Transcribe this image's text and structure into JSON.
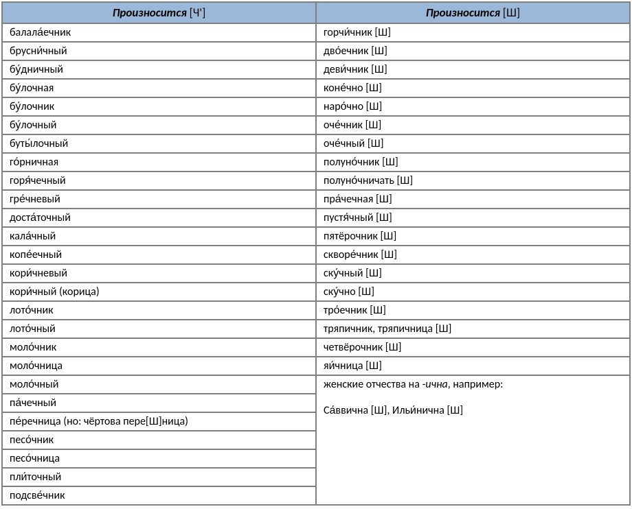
{
  "headers": {
    "col1_italic": "Произносится",
    "col1_suffix": " [Ч']",
    "col2_italic": "Произносится",
    "col2_suffix": " [Ш]"
  },
  "rows": [
    {
      "c1": "балала́ечник",
      "c2": "горчи́чник [Ш]"
    },
    {
      "c1": "брусни́чный",
      "c2": "дво́ечник [Ш]"
    },
    {
      "c1": "бу́дничный",
      "c2": "деви́чник [Ш]"
    },
    {
      "c1": "бу́лочная",
      "c2": "коне́чно [Ш]"
    },
    {
      "c1": "бу́лочник",
      "c2": "наро́чно [Ш]"
    },
    {
      "c1": "бу́лочный",
      "c2": "оче́чник [Ш]"
    },
    {
      "c1": "буты́лочный",
      "c2": "оче́чный [Ш]"
    },
    {
      "c1": "го́рничная",
      "c2": "полуно́чник [Ш]"
    },
    {
      "c1": "горя́чечный",
      "c2": "полуно́чничать [Ш]"
    },
    {
      "c1": "гре́чневый",
      "c2": "пра́чечная [Ш]"
    },
    {
      "c1": "доста́точный",
      "c2": "пустя́чный [Ш]"
    },
    {
      "c1": "кала́чный",
      "c2": "пятёрочник [Ш]"
    },
    {
      "c1": "копе́ечный",
      "c2": "скворе́чник [Ш]"
    },
    {
      "c1": "кори́чневый",
      "c2": "ску́чный [Ш]"
    },
    {
      "c1": "кори́чный (корица)",
      "c2": "ску́чно [Ш]"
    },
    {
      "c1": "лото́чник",
      "c2": "тро́ечник [Ш]"
    },
    {
      "c1": "лото́чный",
      "c2": "тряпичник, тряпичница [Ш]"
    },
    {
      "c1": "моло́чник",
      "c2": "четвёрочник [Ш]"
    },
    {
      "c1": "моло́чница",
      "c2": "яи́чница [Ш]"
    }
  ],
  "merged": {
    "line1_prefix": "женские отчества на ",
    "line1_italic": "-ична",
    "line1_suffix": ", например:",
    "line2": " Са́ввична [Ш], Ильи́нична [Ш]"
  },
  "tail_col1": [
    "моло́чный",
    "па́чечный",
    "пе́речница (но: чёртова пере[Ш]ница)",
    "песо́чник",
    "песо́чница",
    "пли́точный",
    "подсве́чник"
  ]
}
